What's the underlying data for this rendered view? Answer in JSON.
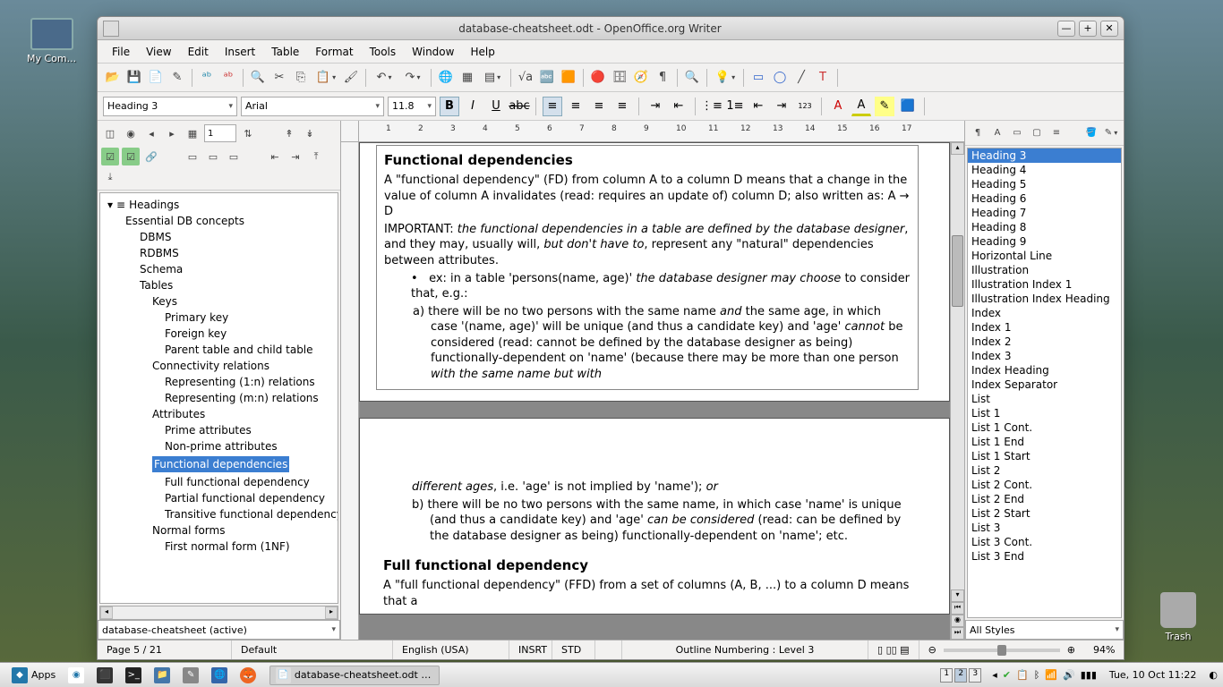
{
  "desktop": {
    "mycomputer": "My Com...",
    "trash": "Trash"
  },
  "window": {
    "title": "database-cheatsheet.odt - OpenOffice.org Writer"
  },
  "menu": [
    "File",
    "View",
    "Edit",
    "Insert",
    "Table",
    "Format",
    "Tools",
    "Window",
    "Help"
  ],
  "format": {
    "style": "Heading 3",
    "font": "Arial",
    "size": "11.8"
  },
  "navigator": {
    "spin": "1",
    "root": "Headings",
    "tree": [
      {
        "t": "Essential DB concepts",
        "l": 1
      },
      {
        "t": "DBMS",
        "l": 2
      },
      {
        "t": "RDBMS",
        "l": 2
      },
      {
        "t": "Schema",
        "l": 2
      },
      {
        "t": "Tables",
        "l": 2
      },
      {
        "t": "Keys",
        "l": 3
      },
      {
        "t": "Primary key",
        "l": 4
      },
      {
        "t": "Foreign key",
        "l": 4
      },
      {
        "t": "Parent table and child table",
        "l": 4
      },
      {
        "t": "Connectivity relations",
        "l": 3
      },
      {
        "t": "Representing (1:n) relations",
        "l": 4
      },
      {
        "t": "Representing (m:n) relations",
        "l": 4
      },
      {
        "t": "Attributes",
        "l": 3
      },
      {
        "t": "Prime attributes",
        "l": 4
      },
      {
        "t": "Non-prime attributes",
        "l": 4
      },
      {
        "t": "Functional dependencies",
        "l": 4,
        "sel": true
      },
      {
        "t": "Full functional dependency",
        "l": 4
      },
      {
        "t": "Partial functional dependency",
        "l": 4
      },
      {
        "t": "Transitive functional dependency",
        "l": 4
      },
      {
        "t": "Normal forms",
        "l": 3
      },
      {
        "t": "First normal form (1NF)",
        "l": 4
      }
    ],
    "doc_combo": "database-cheatsheet (active)"
  },
  "ruler_ticks": [
    "1",
    "2",
    "3",
    "4",
    "5",
    "6",
    "7",
    "8",
    "9",
    "10",
    "11",
    "12",
    "13",
    "14",
    "15",
    "16",
    "17"
  ],
  "doc": {
    "h3": "Functional dependencies",
    "p1a": "A \"functional dependency\" (FD) from column A to a column D means that a change in the value of column A invalidates (read: requires an update of) column D; also written as: A → D",
    "p2_lead": "IMPORTANT: ",
    "p2_em1": "the functional dependencies in a table are defined by the database designer",
    "p2_mid": ", and they may, usually will, ",
    "p2_em2": "but don't have to",
    "p2_end": ", represent any \"natural\" dependencies between attributes.",
    "li1a": "ex: in a table 'persons(name, age)' ",
    "li1em": "the database designer may choose",
    "li1b": " to consider that, e.g.:",
    "sub_a_lead": "a)   there will be no two persons with the same name ",
    "sub_a_em1": "and",
    "sub_a_mid": " the same age, in which case '(name, age)' will be unique (and thus a candidate key) and 'age' ",
    "sub_a_em2": "cannot",
    "sub_a_mid2": " be considered (read: cannot be defined by the database designer as being) functionally-dependent on 'name' (because there may be more than one person ",
    "sub_a_em3": "with the same name but with",
    "page2_cont_em": "different ages",
    "page2_cont": ", i.e. 'age' is not implied by 'name'); ",
    "page2_cont_em2": "or",
    "sub_b_lead": "b)   there will be no two persons with the same name, in which case 'name' is unique (and thus a candidate key) and 'age' ",
    "sub_b_em": "can be considered",
    "sub_b_end": " (read: can be defined by the database designer as being) functionally-dependent on 'name'; etc.",
    "h3b": "Full functional dependency",
    "p3": "A \"full functional dependency\" (FFD) from a set of columns (A, B, ...) to a column D means that a"
  },
  "styles": {
    "list": [
      "Heading 3",
      "Heading 4",
      "Heading 5",
      "Heading 6",
      "Heading 7",
      "Heading 8",
      "Heading 9",
      "Horizontal Line",
      "Illustration",
      "Illustration Index 1",
      "Illustration Index Heading",
      "Index",
      "Index 1",
      "Index 2",
      "Index 3",
      "Index Heading",
      "Index Separator",
      "List",
      "List 1",
      "List 1 Cont.",
      "List 1 End",
      "List 1 Start",
      "List 2",
      "List 2 Cont.",
      "List 2 End",
      "List 2 Start",
      "List 3",
      "List 3 Cont.",
      "List 3 End"
    ],
    "selected": "Heading 3",
    "filter": "All Styles"
  },
  "status": {
    "page": "Page 5 / 21",
    "template": "Default",
    "lang": "English (USA)",
    "insert": "INSRT",
    "sel": "STD",
    "outline": "Outline Numbering : Level 3",
    "zoom": "94%"
  },
  "taskbar": {
    "apps": "Apps",
    "active_task": "database-cheatsheet.odt - O...",
    "workspaces": [
      "1",
      "2",
      "3"
    ],
    "active_ws": "2",
    "clock": "Tue, 10 Oct 11:22"
  }
}
